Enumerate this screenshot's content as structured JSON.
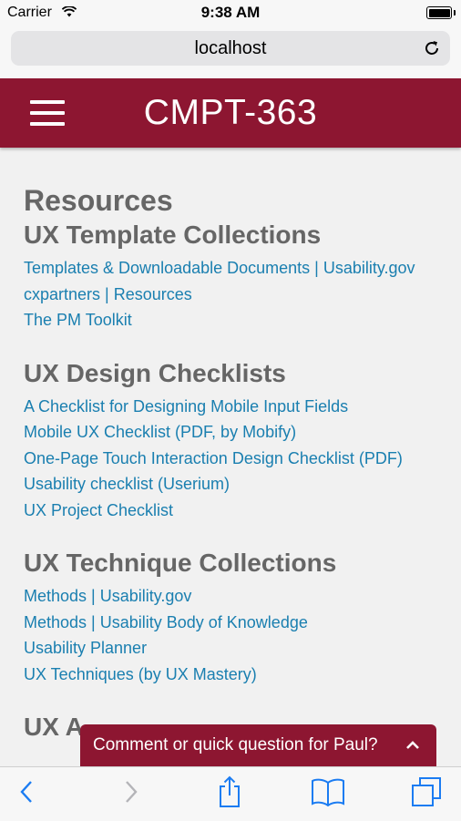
{
  "status_bar": {
    "carrier": "Carrier",
    "time": "9:38 AM"
  },
  "browser": {
    "url": "localhost"
  },
  "header": {
    "title": "CMPT-363"
  },
  "page": {
    "title": "Resources"
  },
  "sections": [
    {
      "title": "UX Template Collections",
      "links": [
        "Templates & Downloadable Documents | Usability.gov",
        "cxpartners | Resources",
        "The PM Toolkit"
      ]
    },
    {
      "title": "UX Design Checklists",
      "links": [
        "A Checklist for Designing Mobile Input Fields",
        "Mobile UX Checklist (PDF, by Mobify)",
        "One-Page Touch Interaction Design Checklist (PDF)",
        "Usability checklist (Userium)",
        "UX Project Checklist"
      ]
    },
    {
      "title": "UX Technique Collections",
      "links": [
        "Methods | Usability.gov",
        "Methods | Usability Body of Knowledge",
        "Usability Planner",
        "UX Techniques (by UX Mastery)"
      ]
    },
    {
      "title": "UX A",
      "links": []
    }
  ],
  "comment_widget": {
    "label": "Comment or quick question for Paul?"
  },
  "colors": {
    "brand": "#8d1631",
    "link": "#1a7fb0",
    "ios_blue": "#1b7cf2"
  }
}
